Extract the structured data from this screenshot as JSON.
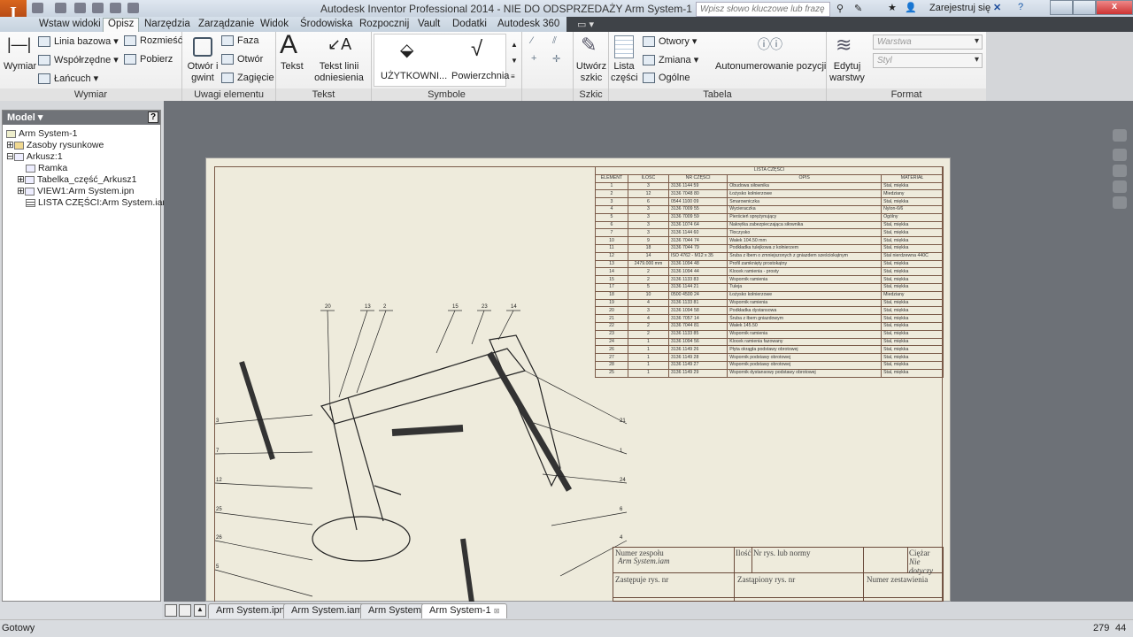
{
  "app": {
    "logo_text": "I",
    "title": "Autodesk Inventor Professional 2014 - NIE DO ODSPRZEDAŻY   Arm System-1",
    "search_placeholder": "Wpisz słowo kluczowe lub frazę",
    "sign_in": "Zarejestruj się"
  },
  "ribbon_tabs": [
    "Wstaw widoki",
    "Opisz",
    "Narzędzia",
    "Zarządzanie",
    "Widok",
    "Środowiska",
    "Rozpocznij",
    "Vault",
    "Dodatki",
    "Autodesk 360"
  ],
  "active_tab": "Opisz",
  "ribbon": {
    "wymiar": {
      "label": "Wymiar",
      "big": "Wymiar",
      "items": [
        "Linia bazowa",
        "Współrzędne",
        "Łańcuch",
        "Rozmieść",
        "Pobierz"
      ]
    },
    "uwagi": {
      "label": "Uwagi elementu",
      "big": "Otwór i gwint",
      "items": [
        "Faza",
        "Otwór",
        "Zagięcie"
      ]
    },
    "tekst": {
      "label": "Tekst",
      "items": [
        "Tekst",
        "Tekst linii odniesienia"
      ]
    },
    "symbole": {
      "label": "Symbole",
      "items": [
        "UŻYTKOWNI...",
        "Powierzchnia"
      ]
    },
    "szkic": {
      "label": "Szkic",
      "big": "Utwórz szkic"
    },
    "tabela": {
      "label": "Tabela",
      "big": "Lista części",
      "items": [
        "Otwory",
        "Zmiana",
        "Ogólne"
      ],
      "auto": "Autonumerowanie pozycji"
    },
    "format": {
      "label": "Format",
      "big": "Edytuj warstwy",
      "layer_placeholder": "Warstwa",
      "style_placeholder": "Styl"
    }
  },
  "browser": {
    "title": "Model",
    "items": [
      "Arm System-1",
      "Zasoby rysunkowe",
      "Arkusz:1",
      "Ramka",
      "Tabelka_część_Arkusz1",
      "VIEW1:Arm System.ipn",
      "LISTA CZĘŚCI:Arm System.iam"
    ]
  },
  "parts_list": {
    "title": "LISTA CZĘŚCI",
    "headers": [
      "ELEMENT",
      "ILOŚĆ",
      "NR CZĘŚCI",
      "OPIS",
      "MATERIAŁ"
    ],
    "rows": [
      [
        "1",
        "3",
        "3136 1144 59",
        "Obudowa siłownika",
        "Stal, miękka"
      ],
      [
        "2",
        "12",
        "3136 7048 80",
        "Łożysko kołnierzowe",
        "Miedziany"
      ],
      [
        "3",
        "6",
        "0544 1100 09",
        "Smarowniczka",
        "Stal, miękka"
      ],
      [
        "4",
        "3",
        "3136 7009 55",
        "Wycieraczka",
        "Nylon-6/6"
      ],
      [
        "5",
        "3",
        "3136 7009 59",
        "Pierścień sprężynujący",
        "Ogólny"
      ],
      [
        "6",
        "3",
        "3136 1074 64",
        "Nakrętka zabezpieczająca siłownika",
        "Stal, miękka"
      ],
      [
        "7",
        "3",
        "3136 1144 60",
        "Tłoczysko",
        "Stal, miękka"
      ],
      [
        "10",
        "9",
        "3136 7044 74",
        "Wałek 104.50 mm",
        "Stal, miękka"
      ],
      [
        "11",
        "18",
        "3136 7044 79",
        "Podkładka tulejkowa z kołnierzem",
        "Stal, miękka"
      ],
      [
        "12",
        "14",
        "ISO 4762 - M12 x 35",
        "Śruba z łbem o zmniejszonych z gniazdem sześciokątnym",
        "Stal nierdzewna 440C"
      ],
      [
        "13",
        "2479.000 mm",
        "3136 1094 48",
        "Profil zamknięty prostokątny",
        "Stal, miękka"
      ],
      [
        "14",
        "2",
        "3136 1094 44",
        "Klocek ramienia - prosty",
        "Stal, miękka"
      ],
      [
        "15",
        "2",
        "3136 1133 83",
        "Wspornik ramienia",
        "Stal, miękka"
      ],
      [
        "17",
        "5",
        "3136 1144 21",
        "Tuleja",
        "Stal, miękka"
      ],
      [
        "18",
        "10",
        "0500 4500 24",
        "Łożysko kołnierzowe",
        "Miedziany"
      ],
      [
        "19",
        "4",
        "3136 1133 81",
        "Wspornik ramienia",
        "Stal, miękka"
      ],
      [
        "20",
        "3",
        "3136 1094 58",
        "Podkładka dystansowa",
        "Stal, miękka"
      ],
      [
        "21",
        "4",
        "3136 7057 14",
        "Śruba z łbem gniazdowym",
        "Stal, miękka"
      ],
      [
        "22",
        "2",
        "3136 7044 81",
        "Wałek 145.50",
        "Stal, miękka"
      ],
      [
        "23",
        "2",
        "3136 1133 85",
        "Wspornik ramienia",
        "Stal, miękka"
      ],
      [
        "24",
        "1",
        "3136 1094 56",
        "Klocek ramienia fazowany",
        "Stal, miękka"
      ],
      [
        "26",
        "1",
        "3136 1149 26",
        "Płyta okrągła podstawy obrotowej",
        "Stal, miękka"
      ],
      [
        "27",
        "1",
        "3136 1149 28",
        "Wspornik podstawy obrotowej",
        "Stal, miękka"
      ],
      [
        "28",
        "1",
        "3136 1149 27",
        "Wspornik podstawy obrotowej",
        "Stal, miękka"
      ],
      [
        "25",
        "1",
        "3136 1149 29",
        "Wspornik dystansowy podstawy obrotowej",
        "Stal, miękka"
      ]
    ]
  },
  "balloons": {
    "top": [
      "20",
      "13",
      "2",
      "15",
      "23",
      "14"
    ],
    "left": [
      "3",
      "7",
      "12",
      "25",
      "26",
      "5"
    ],
    "right": [
      "21",
      "1",
      "24",
      "6",
      "4"
    ]
  },
  "title_block": {
    "numer_zespolu": "Numer zespołu",
    "zespol_value": "Arm System.iam",
    "ilosc": "Ilość",
    "nr_rys": "Nr rys. lub normy",
    "ciezar": "Ciężar",
    "ciezar_value": "Nie dotyczy",
    "zastepuje": "Zastępuje rys. nr",
    "zastapiony": "Zastąpiony rys. nr",
    "numer_zestawienia": "Numer zestawienia"
  },
  "doc_tabs": [
    "Arm System.ipn",
    "Arm System.iam",
    "Arm System",
    "Arm System-1"
  ],
  "active_doc": "Arm System-1",
  "status": {
    "text": "Gotowy",
    "x": "279",
    "y": "44"
  }
}
